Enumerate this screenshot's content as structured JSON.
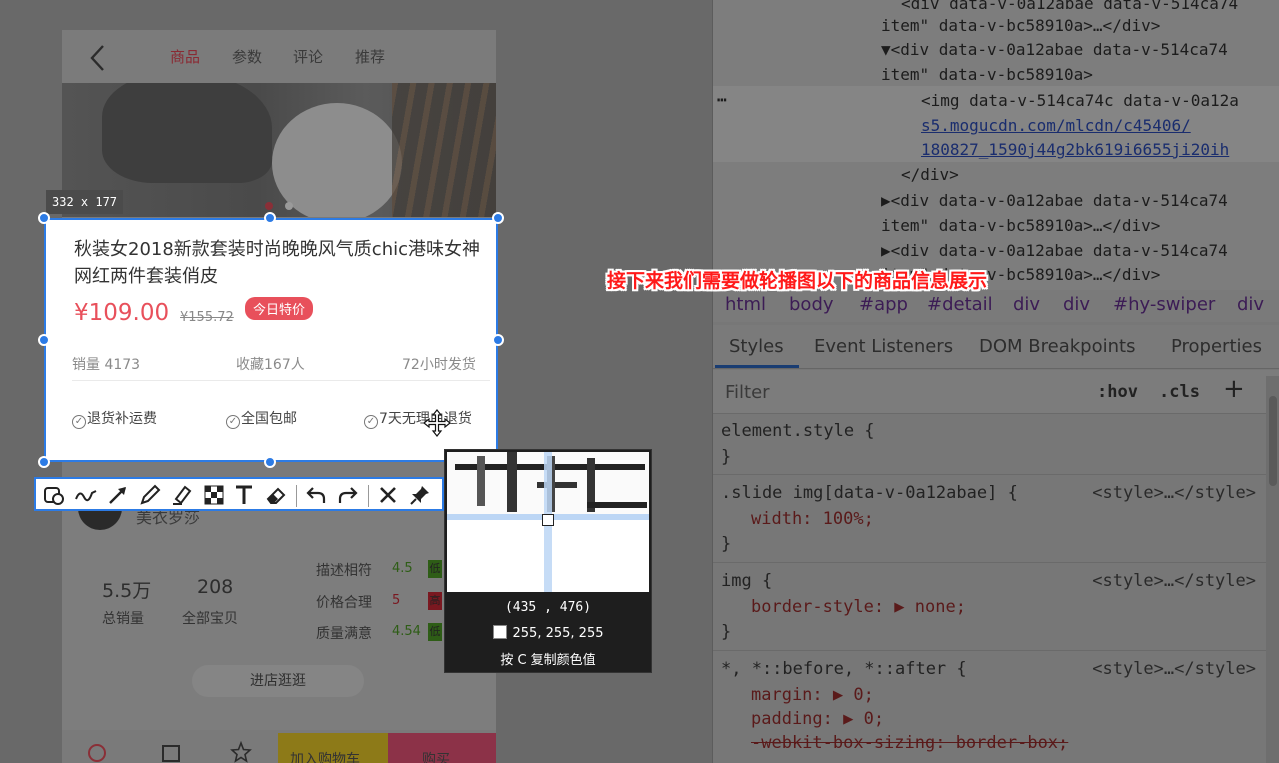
{
  "phone": {
    "nav_tabs": [
      "商品",
      "参数",
      "评论",
      "推荐"
    ],
    "shop": {
      "name": "美衣罗莎",
      "stats": [
        {
          "value": "5.5万",
          "label": "总销量"
        },
        {
          "value": "208",
          "label": "全部宝贝"
        }
      ],
      "scores": [
        {
          "label": "描述相符",
          "value": "4.5",
          "badge": "低",
          "color": "#2e5d16"
        },
        {
          "label": "价格合理",
          "value": "5",
          "badge": "高",
          "color": "#7a1820"
        },
        {
          "label": "质量满意",
          "value": "4.54",
          "badge": "低",
          "color": "#2e5d16"
        }
      ],
      "enter_button": "进店逛逛"
    },
    "bottom_bar": {
      "add_cart": "加入购物车",
      "buy": "购买"
    }
  },
  "capture": {
    "size_label": "332 x 177",
    "product": {
      "title": "秋装女2018新款套装时尚晚晚风气质chic港味女神网红两件套装俏皮",
      "price": "¥109.00",
      "old_price": "¥155.72",
      "badge": "今日特价",
      "meta": [
        "销量 4173",
        "收藏167人",
        "72小时发货"
      ],
      "services": [
        "退货补运费",
        "全国包邮",
        "7天无理由退货"
      ]
    }
  },
  "magnifier": {
    "coords": "(435 , 476)",
    "rgb": "255, 255, 255",
    "hint": "按 C 复制颜色值"
  },
  "annotation": "接下来我们需要做轮播图以下的商品信息展示",
  "devtools": {
    "dom_lines": [
      "<div data-v-0a12abae data-v-514ca74",
      "item\" data-v-bc58910a>…</div>",
      "▼<div data-v-0a12abae data-v-514ca74",
      "item\" data-v-bc58910a>",
      "<img data-v-514ca74c data-v-0a12a",
      "s5.mogucdn.com/mlcdn/c45406/",
      "180827_1590j44g2bk619i6655ji20ih",
      "</div>",
      "▶<div data-v-0a12abae data-v-514ca74",
      "item\" data-v-bc58910a>…</div>",
      "▶<div data-v-0a12abae data-v-514ca74",
      "item\" data-v-bc58910a>…</div>"
    ],
    "breadcrumbs": [
      "html",
      "body",
      "#app",
      "#detail",
      "div",
      "div",
      "#hy-swiper",
      "div"
    ],
    "panel_tabs": [
      "Styles",
      "Event Listeners",
      "DOM Breakpoints",
      "Properties"
    ],
    "filter_placeholder": "Filter",
    "hov": ":hov",
    "cls": ".cls",
    "new_rule": "+",
    "styles": {
      "element_style": "element.style {",
      "close": "}",
      "rule1_selector": ".slide img[data-v-0a12abae] {",
      "rule1_prop": "width: 100%;",
      "rule2_selector": "img {",
      "rule2_prop": "border-style: ▶ none;",
      "rule3_selector": "*, *::before, *::after {",
      "rule3_prop1": "margin: ▶ 0;",
      "rule3_prop2": "padding: ▶ 0;",
      "rule3_prop3": "-webkit-box-sizing: border-box;",
      "source": "<style>…</style>"
    }
  }
}
